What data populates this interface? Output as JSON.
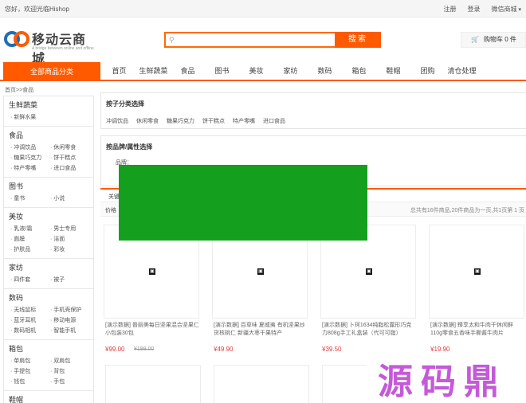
{
  "topbar": {
    "welcome": "您好，欢迎光临Hishop",
    "links": [
      "注册",
      "登录",
      "微信商城"
    ]
  },
  "header": {
    "logo_name": "移动云商城",
    "logo_slogan": "A bridge between online and offline",
    "search_placeholder": "",
    "search_button": "搜索",
    "cart_label": "购物车 0 件"
  },
  "nav": {
    "all_categories": "全部商品分类",
    "items": [
      "首页",
      "生鲜蔬菜",
      "食品",
      "图书",
      "美妆",
      "家纺",
      "数码",
      "箱包",
      "鞋帽",
      "团购",
      "清仓处理"
    ]
  },
  "breadcrumb": "首页>>食品",
  "sidebar": {
    "categories": [
      {
        "title": "生鲜蔬菜",
        "subs": [
          "新鲜水果"
        ]
      },
      {
        "title": "食品",
        "subs": [
          "冲调饮品",
          "休闲零食",
          "糖果巧克力",
          "饼干糕点",
          "特产零嘴",
          "进口食品"
        ]
      },
      {
        "title": "图书",
        "subs": [
          "童书",
          "小说"
        ]
      },
      {
        "title": "美妆",
        "subs": [
          "乳液/霜",
          "男士专用",
          "面膜",
          "洁面",
          "护肤品",
          "彩妆"
        ]
      },
      {
        "title": "家纺",
        "subs": [
          "四件套",
          "被子"
        ]
      },
      {
        "title": "数码",
        "subs": [
          "无线鼠标",
          "手机壳保护",
          "蓝牙耳机",
          "移动电源",
          "数码相机",
          "智能手机"
        ]
      },
      {
        "title": "箱包",
        "subs": [
          "单肩包",
          "双肩包",
          "手提包",
          "背包",
          "钱包",
          "手包"
        ]
      },
      {
        "title": "鞋帽",
        "subs": []
      }
    ]
  },
  "filter": {
    "subcategory_title": "按子分类选择",
    "subcategories": [
      "冲调饮品",
      "休闲零食",
      "糖果巧克力",
      "饼干糕点",
      "特产零嘴",
      "进口食品"
    ],
    "brand_title": "按品牌/属性选择",
    "brand_label": "品牌："
  },
  "sort": {
    "row1": "关键",
    "row2": "价格",
    "summary": "总共有16件商品,20件商品为一页,共1页第 1 页"
  },
  "products": [
    {
      "title": "[演示数据] 普丽美每日坚果混合坚果仁小包装30包",
      "price": "¥99.00",
      "old_price": "¥199.00",
      "icon": "image-icon"
    },
    {
      "title": "[演示数据] 百草味 夏威夷 有机坚果炒货核桃仁 新疆大枣干果特产",
      "price": "¥49.90",
      "old_price": "",
      "icon": "image-icon"
    },
    {
      "title": "[演示数据] 卜珂1634纯脂松露形巧克力808g手工礼盒装（代可可脂）",
      "price": "¥39.50",
      "old_price": "",
      "icon": "image-icon"
    },
    {
      "title": "[演示数据] 臻享太和牛肉干休闲鲜110g零食五香味手撕酱牛肉片",
      "price": "¥19.90",
      "old_price": "",
      "icon": "image-icon"
    }
  ],
  "watermark": "源码鼎",
  "colors": {
    "accent": "#ff5a00",
    "price": "#e4393c",
    "green_block": "#14a01e",
    "watermark": "#c45ad8"
  }
}
